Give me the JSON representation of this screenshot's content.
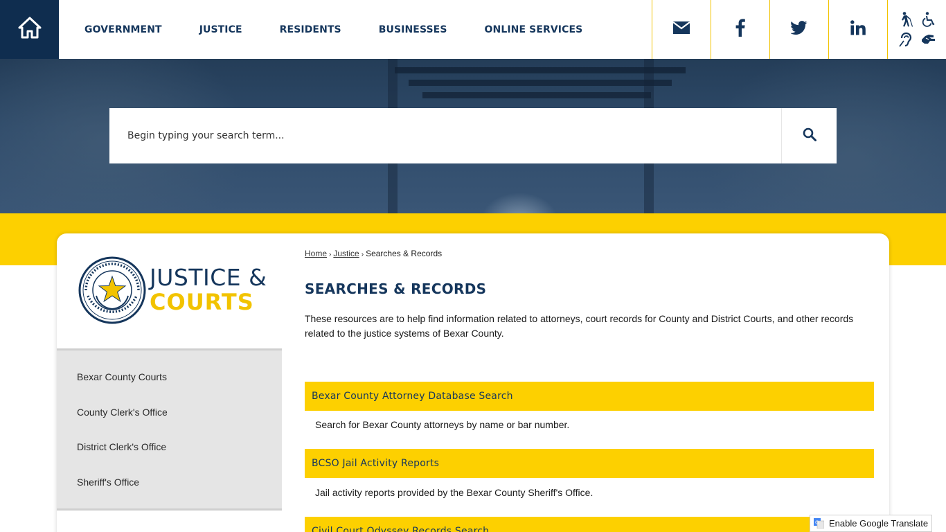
{
  "nav": {
    "items": [
      {
        "label": "GOVERNMENT"
      },
      {
        "label": "JUSTICE"
      },
      {
        "label": "RESIDENTS"
      },
      {
        "label": "BUSINESSES"
      },
      {
        "label": "ONLINE SERVICES"
      }
    ]
  },
  "social": {
    "email_icon": "envelope-icon",
    "facebook_icon": "facebook-icon",
    "twitter_icon": "twitter-icon",
    "linkedin_icon": "linkedin-icon"
  },
  "search": {
    "placeholder": "Begin typing your search term...",
    "button_icon": "search-icon"
  },
  "logo": {
    "seal_text": "THE STATE OF TEXAS · COUNTY OF BEXAR",
    "title_line1": "JUSTICE &",
    "title_line2": "COURTS"
  },
  "sidebar": {
    "items": [
      {
        "label": "Bexar County Courts"
      },
      {
        "label": "County Clerk's Office"
      },
      {
        "label": "District Clerk's Office"
      },
      {
        "label": "Sheriff's Office"
      }
    ]
  },
  "breadcrumb": {
    "home": "Home",
    "sep": "›",
    "section": "Justice",
    "current": "Searches & Records"
  },
  "page": {
    "title": "SEARCHES & RECORDS",
    "intro": "These resources are to help find information related to attorneys, court records for County and District Courts, and other records related to the justice systems of Bexar County."
  },
  "resources": [
    {
      "title": "Bexar County Attorney Database Search",
      "description": "Search for Bexar County attorneys by name or bar number."
    },
    {
      "title": "BCSO Jail Activity Reports",
      "description": "Jail activity reports provided by the Bexar County Sheriff's Office."
    },
    {
      "title": "Civil Court Odyssey Records Search",
      "description": ""
    }
  ],
  "translate": {
    "label": "Enable Google Translate"
  },
  "colors": {
    "navy": "#15365c",
    "home_bg": "#0f2d4f",
    "accent_yellow": "#fdd000",
    "sidebar_bg": "#e5e5e5"
  }
}
